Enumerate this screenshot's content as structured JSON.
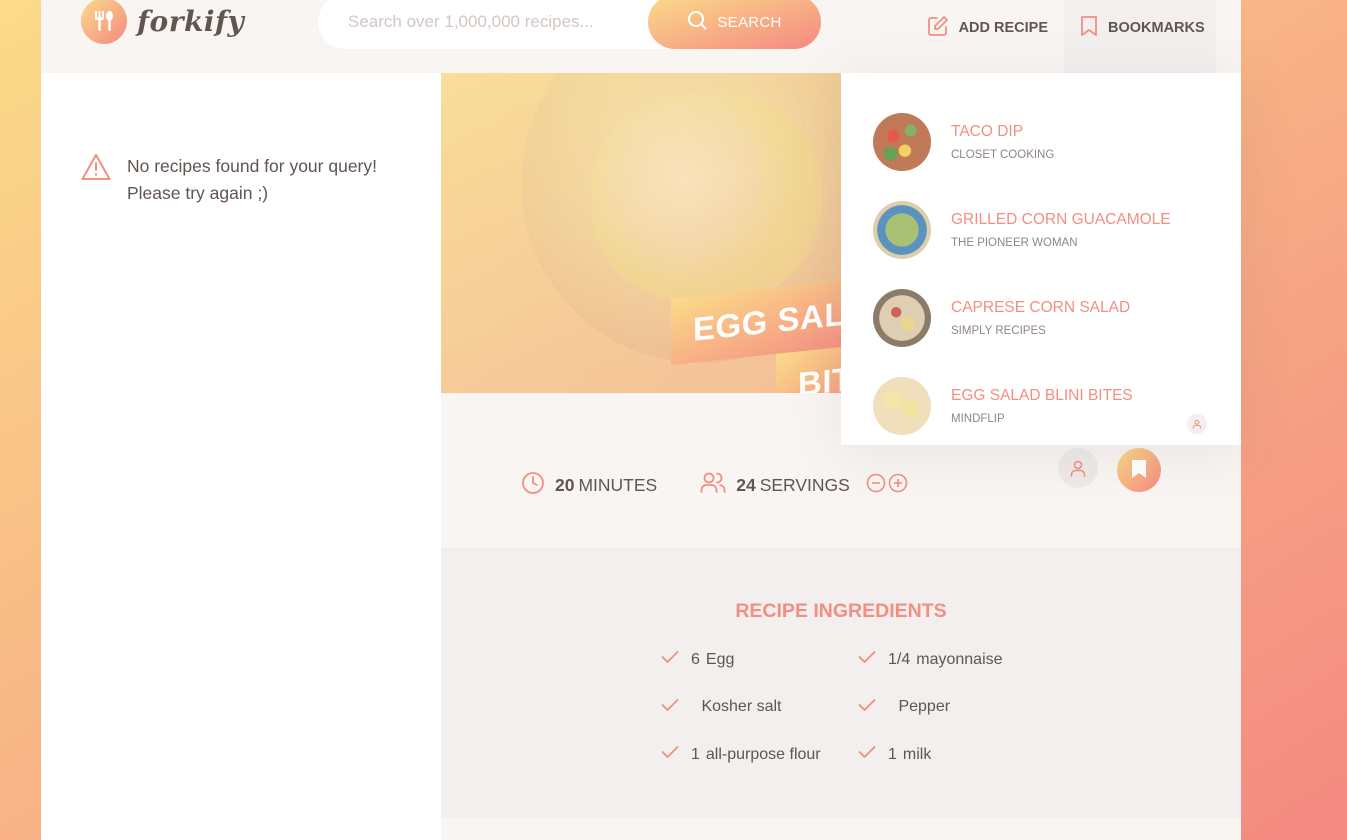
{
  "header": {
    "logo_text": "forkify",
    "search_placeholder": "Search over 1,000,000 recipes...",
    "search_button": "SEARCH",
    "add_recipe": "ADD RECIPE",
    "bookmarks": "BOOKMARKS"
  },
  "results": {
    "error_line1": "No recipes found for your query!",
    "error_line2": "Please try again ;)"
  },
  "recipe": {
    "title_line1": "EGG SALA",
    "title_line2": "BIT",
    "minutes_value": "20",
    "minutes_label": "MINUTES",
    "servings_value": "24",
    "servings_label": "SERVINGS"
  },
  "ingredients": {
    "title": "RECIPE INGREDIENTS",
    "items": [
      {
        "qty": "6",
        "desc": "Egg"
      },
      {
        "qty": "1/4",
        "desc": "mayonnaise"
      },
      {
        "qty": " ",
        "desc": "Kosher salt"
      },
      {
        "qty": " ",
        "desc": "Pepper"
      },
      {
        "qty": "1",
        "desc": "all-purpose flour"
      },
      {
        "qty": "1",
        "desc": "milk"
      }
    ]
  },
  "bookmarks_list": [
    {
      "name": "TACO DIP",
      "publisher": "CLOSET COOKING",
      "user_generated": false
    },
    {
      "name": "GRILLED CORN GUACAMOLE",
      "publisher": "THE PIONEER WOMAN",
      "user_generated": false
    },
    {
      "name": "CAPRESE CORN SALAD",
      "publisher": "SIMPLY RECIPES",
      "user_generated": false
    },
    {
      "name": "EGG SALAD BLINI BITES",
      "publisher": "MINDFLIP",
      "user_generated": true
    }
  ],
  "colors": {
    "accent": "#f38e82",
    "gradient_start": "#fbdb89",
    "gradient_end": "#f48982",
    "text": "#615551"
  }
}
